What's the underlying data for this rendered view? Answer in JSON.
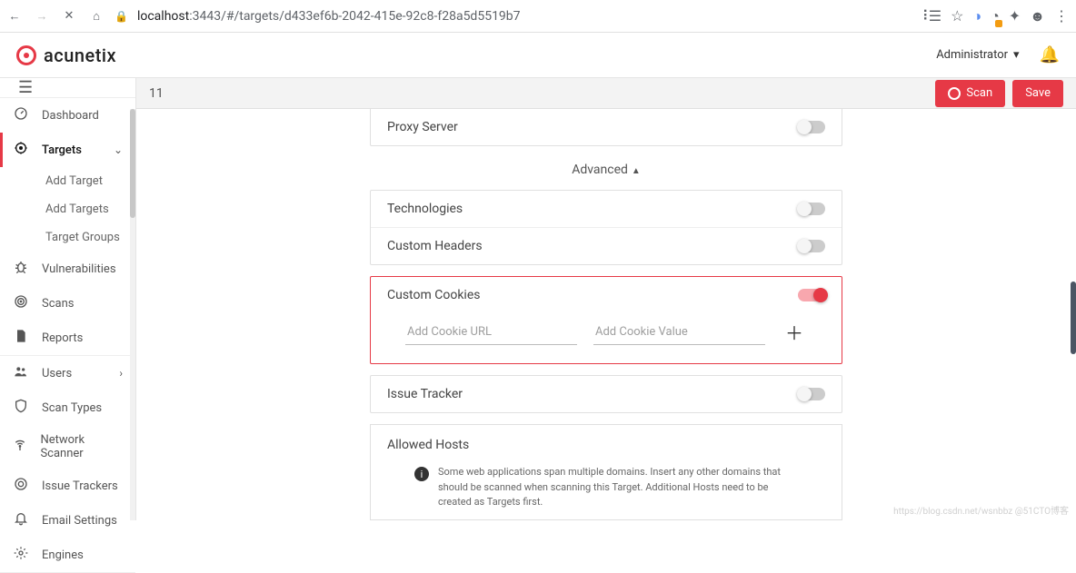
{
  "browser": {
    "url_prefix": "localhost",
    "url_rest": ":3443/#/targets/d433ef6b-2042-415e-92c8-f28a5d5519b7"
  },
  "brand": "acunetix",
  "header": {
    "user": "Administrator"
  },
  "sidebar": {
    "dashboard": "Dashboard",
    "targets": "Targets",
    "add_target": "Add Target",
    "add_targets": "Add Targets",
    "target_groups": "Target Groups",
    "vulnerabilities": "Vulnerabilities",
    "scans": "Scans",
    "reports": "Reports",
    "users": "Users",
    "scan_types": "Scan Types",
    "network_scanner": "Network Scanner",
    "issue_trackers": "Issue Trackers",
    "email_settings": "Email Settings",
    "engines": "Engines"
  },
  "actionbar": {
    "title": "11",
    "scan": "Scan",
    "save": "Save"
  },
  "panels": {
    "proxy": "Proxy Server",
    "advanced": "Advanced",
    "technologies": "Technologies",
    "custom_headers": "Custom Headers",
    "custom_cookies": "Custom Cookies",
    "cookie_url_ph": "Add Cookie URL",
    "cookie_val_ph": "Add Cookie Value",
    "issue_tracker": "Issue Tracker",
    "allowed_hosts": "Allowed Hosts",
    "allowed_info": "Some web applications span multiple domains. Insert any other domains that should be scanned when scanning this Target. Additional Hosts need to be created as Targets first."
  },
  "watermark": "https://blog.csdn.net/wsnbbz @51CTO博客"
}
